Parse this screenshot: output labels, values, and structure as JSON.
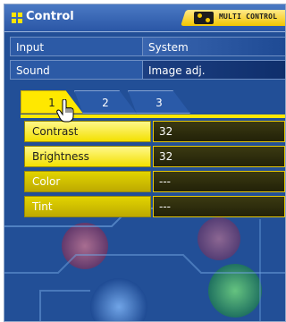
{
  "header": {
    "title": "Control",
    "badge": "MULTI CONTROL"
  },
  "menu": {
    "rows": [
      {
        "left": "Input",
        "right": "System"
      },
      {
        "left": "Sound",
        "right": "Image adj."
      }
    ]
  },
  "tabs": [
    {
      "label": "1"
    },
    {
      "label": "2"
    },
    {
      "label": "3"
    }
  ],
  "settings": [
    {
      "label": "Contrast",
      "value": "32"
    },
    {
      "label": "Brightness",
      "value": "32"
    },
    {
      "label": "Color",
      "value": "---"
    },
    {
      "label": "Tint",
      "value": "---"
    }
  ],
  "colors": {
    "accent": "#ffe800",
    "background": "#1f4f96"
  }
}
